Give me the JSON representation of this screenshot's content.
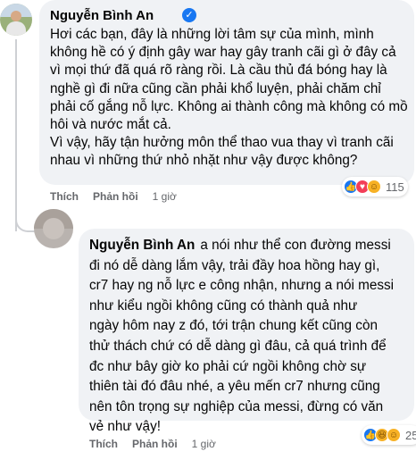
{
  "comment": {
    "author": "Nguyễn Bình An",
    "verified_symbol": "✓",
    "text": [
      "Hơi các bạn, đây là những lời tâm sự của mình, mình không hề có ý định gây war hay gây tranh cãi gì ở đây cả vì mọi thứ đã quá rõ ràng rồi. Là cầu thủ đá bóng hay là nghề gì đi nữa cũng cần phải khổ luyện, phải chăm chỉ phải cố gắng nỗ lực. Không ai thành công mà không có mồ hôi và nước mắt cả.",
      "Vì vậy, hãy tận hưởng môn thể thao vua thay vì tranh cãi nhau vì những thứ nhỏ nhặt như vậy được không?"
    ],
    "like_label": "Thích",
    "reply_label": "Phản hồi",
    "time": "1 giờ",
    "reactions": [
      "like",
      "love",
      "care"
    ],
    "reaction_count": "115"
  },
  "reply": {
    "author": "Nguyễn Bình An",
    "first_line": "a nói như thể con đường messi",
    "lines": [
      "đi nó dễ dàng lắm vậy, trải đầy hoa hồng hay gì,",
      "cr7 hay ng nỗ lực e công nhận, nhưng a nói messi",
      "như kiểu ngồi không cũng có thành quả như",
      "ngày hôm nay z đó, tới trận chung kết cũng còn",
      "thử thách chứ có dễ dàng gì đâu, cả quá trình để",
      "đc như bây giờ ko phải cứ ngồi không chờ sự",
      "thiên tài đó đâu nhé, a yêu mến cr7 nhưng cũng",
      "nên tôn trọng sự nghiệp của messi, đừng có văn",
      "vẻ như vậy!"
    ],
    "like_label": "Thích",
    "reply_label": "Phản hồi",
    "time": "1 giờ",
    "reactions": [
      "like",
      "haha",
      "care"
    ],
    "reaction_count": "25"
  },
  "colors": {
    "bubble": "#f0f2f5",
    "meta": "#65676b",
    "verified": "#1877f2",
    "like": "#1877f2",
    "love": "#f33e58",
    "care": "#f7b125"
  }
}
